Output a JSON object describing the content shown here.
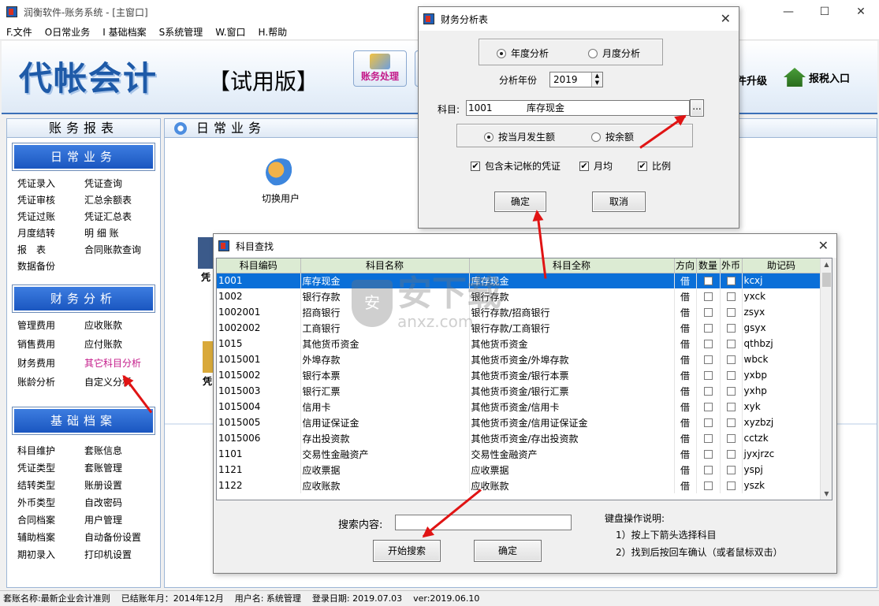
{
  "window": {
    "title": "润衡软件-账务系统 - [主窗口]",
    "controls": [
      "—",
      "☐",
      "✕"
    ]
  },
  "menu": [
    "F.文件",
    "O日常业务",
    "I 基础档案",
    "S系统管理",
    "W.窗口",
    "H.帮助"
  ],
  "banner": {
    "logo": "代帐会计",
    "trial": "【试用版】",
    "toolbar_button": "账务处理",
    "upgrade": "件升级",
    "tax_entry": "报税入口",
    "tax_icon": "tax-house-icon"
  },
  "left_panel": {
    "title": "账务报表",
    "sections": [
      {
        "title": "日常业务",
        "items": [
          "凭证录入",
          "凭证查询",
          "凭证审核",
          "汇总余额表",
          "凭证过账",
          "凭证汇总表",
          "月度结转",
          "明 细 账",
          "报　表",
          "合同账款查询",
          "数据备份",
          ""
        ]
      },
      {
        "title": "财务分析",
        "items": [
          "管理费用",
          "应收账款",
          "销售费用",
          "应付账款",
          "财务费用",
          "其它科目分析",
          "账龄分析",
          "自定义分析"
        ]
      },
      {
        "title": "基础档案",
        "items": [
          "科目维护",
          "套账信息",
          "凭证类型",
          "套账管理",
          "结转类型",
          "账册设置",
          "外币类型",
          "自改密码",
          "合同档案",
          "用户管理",
          "辅助档案",
          "自动备份设置",
          "期初录入",
          "打印机设置"
        ]
      }
    ],
    "highlight_color": "#c41b8a"
  },
  "content": {
    "title": "日常业务",
    "switch_user": "切换用户",
    "frag_labels": [
      "凭",
      "凭"
    ]
  },
  "status_bar": {
    "set_name": "套账名称:最新企业会计准则",
    "closed_month": "已结账年月：2014年12月",
    "user": "用户名: 系统管理",
    "login_date": "登录日期: 2019.07.03",
    "version": "ver:2019.06.10"
  },
  "analysis_dialog": {
    "title": "财务分析表",
    "close": "✕",
    "radio_year": "年度分析",
    "radio_month": "月度分析",
    "year_label": "分析年份",
    "year_value": "2019",
    "subject_label": "科目:",
    "subject_code": "1001",
    "subject_name": "库存现金",
    "browse": "...",
    "radio_current": "按当月发生额",
    "radio_balance": "按余额",
    "chk_unposted": "包含未记帐的凭证",
    "chk_monthly": "月均",
    "chk_ratio": "比例",
    "ok": "确定",
    "cancel": "取消"
  },
  "lookup_dialog": {
    "title": "科目查找",
    "close": "✕",
    "columns": [
      "科目编码",
      "科目名称",
      "科目全称",
      "方向",
      "数量",
      "外币",
      "助记码"
    ],
    "rows": [
      [
        "1001",
        "库存现金",
        "库存现金",
        "借",
        "kcxj"
      ],
      [
        "1002",
        "银行存款",
        "银行存款",
        "借",
        "yxck"
      ],
      [
        "1002001",
        "招商银行",
        "银行存款/招商银行",
        "借",
        "zsyx"
      ],
      [
        "1002002",
        "工商银行",
        "银行存款/工商银行",
        "借",
        "gsyx"
      ],
      [
        "1015",
        "其他货币资金",
        "其他货币资金",
        "借",
        "qthbzj"
      ],
      [
        "1015001",
        "外埠存款",
        "其他货币资金/外埠存款",
        "借",
        "wbck"
      ],
      [
        "1015002",
        "银行本票",
        "其他货币资金/银行本票",
        "借",
        "yxbp"
      ],
      [
        "1015003",
        "银行汇票",
        "其他货币资金/银行汇票",
        "借",
        "yxhp"
      ],
      [
        "1015004",
        "信用卡",
        "其他货币资金/信用卡",
        "借",
        "xyk"
      ],
      [
        "1015005",
        "信用证保证金",
        "其他货币资金/信用证保证金",
        "借",
        "xyzbzj"
      ],
      [
        "1015006",
        "存出投资款",
        "其他货币资金/存出投资款",
        "借",
        "cctzk"
      ],
      [
        "1101",
        "交易性金融资产",
        "交易性金融资产",
        "借",
        "jyxjrzc"
      ],
      [
        "1121",
        "应收票据",
        "应收票据",
        "借",
        "yspj"
      ],
      [
        "1122",
        "应收账款",
        "应收账款",
        "借",
        "yszk"
      ]
    ],
    "search_label": "搜索内容:",
    "search_value": "",
    "search_button": "开始搜索",
    "ok": "确定",
    "help_title": "键盘操作说明:",
    "help_1": "1）按上下箭头选择科目",
    "help_2": "2）找到后按回车确认（或者鼠标双击）",
    "header_color": "#dcebd3",
    "selected_color": "#0a6fd8"
  },
  "watermark": {
    "big": "安下载",
    "small": "anxz.com",
    "shield": "安"
  }
}
